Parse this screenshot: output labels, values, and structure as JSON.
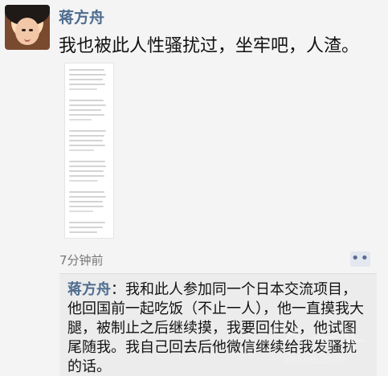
{
  "post": {
    "author_name": "蒋方舟",
    "text": "我也被此人性骚扰过，坐牢吧，人渣。",
    "timestamp": "7分钟前"
  },
  "icons": {
    "avatar": "profile-photo-icon",
    "more": "more-options-icon"
  },
  "comment": {
    "author_name": "蒋方舟",
    "separator": "：",
    "text": "我和此人参加同一个日本交流项目，他回国前一起吃饭（不止一人），他一直摸我大腿，被制止之后继续摸，我要回住处，他试图尾随我。我自己回去后他微信继续给我发骚扰的话。"
  },
  "watermark": {
    "brand": "xiumei.com"
  },
  "colors": {
    "name_blue": "#4f6d8f",
    "background": "#f4f4f4",
    "comment_background": "#ececec"
  }
}
